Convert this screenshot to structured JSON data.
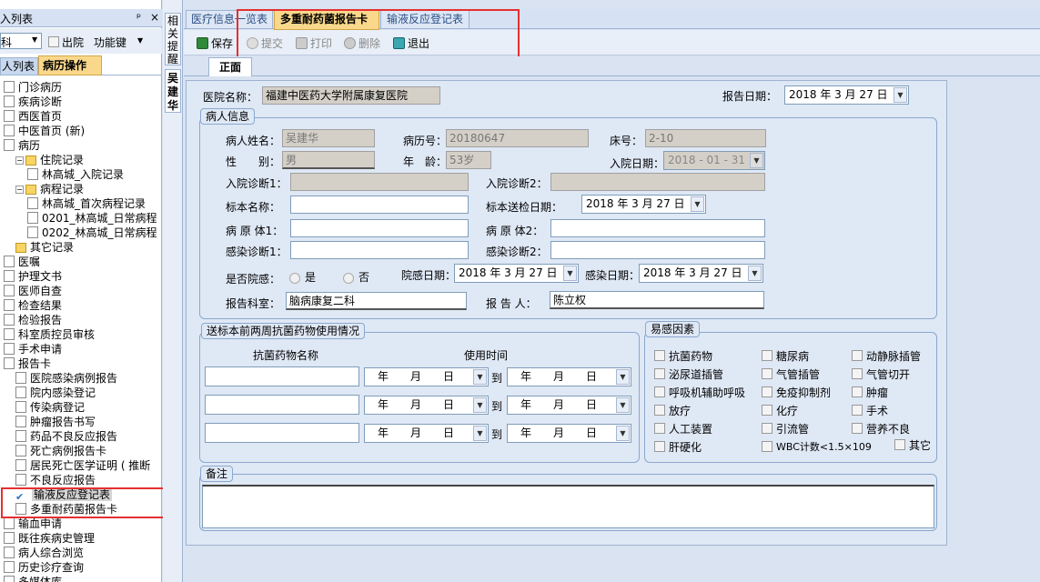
{
  "header": {
    "fragment": "入列表"
  },
  "left": {
    "filter_value": "科",
    "discharge_label": "出院",
    "function_key": "功能键",
    "tabs": [
      "人列表",
      "病历操作"
    ],
    "tree": [
      {
        "label": "门诊病历",
        "indent": 0,
        "icon": "doc"
      },
      {
        "label": "疾病诊断",
        "indent": 0,
        "icon": "doc"
      },
      {
        "label": "西医首页",
        "indent": 0,
        "icon": "doc"
      },
      {
        "label": "中医首页 (新)",
        "indent": 0,
        "icon": "doc"
      },
      {
        "label": "病历",
        "indent": 0,
        "icon": "doc"
      },
      {
        "label": "住院记录",
        "indent": 1,
        "icon": "folder",
        "expander": "−"
      },
      {
        "label": "林高城_入院记录",
        "indent": 2,
        "icon": "doc"
      },
      {
        "label": "病程记录",
        "indent": 1,
        "icon": "folder",
        "expander": "−"
      },
      {
        "label": "林高城_首次病程记录",
        "indent": 2,
        "icon": "doc"
      },
      {
        "label": "0201_林高城_日常病程",
        "indent": 2,
        "icon": "doc"
      },
      {
        "label": "0202_林高城_日常病程",
        "indent": 2,
        "icon": "doc"
      },
      {
        "label": "其它记录",
        "indent": 1,
        "icon": "folder"
      },
      {
        "label": "医嘱",
        "indent": 0,
        "icon": "doc"
      },
      {
        "label": "护理文书",
        "indent": 0,
        "icon": "doc"
      },
      {
        "label": "医师自查",
        "indent": 0,
        "icon": "doc"
      },
      {
        "label": "检查结果",
        "indent": 0,
        "icon": "doc"
      },
      {
        "label": "检验报告",
        "indent": 0,
        "icon": "doc"
      },
      {
        "label": "科室质控员审核",
        "indent": 0,
        "icon": "doc"
      },
      {
        "label": "手术申请",
        "indent": 0,
        "icon": "doc"
      },
      {
        "label": "报告卡",
        "indent": 0,
        "icon": "doc"
      },
      {
        "label": "医院感染病例报告",
        "indent": 1,
        "icon": "doc"
      },
      {
        "label": "院内感染登记",
        "indent": 1,
        "icon": "doc"
      },
      {
        "label": "传染病登记",
        "indent": 1,
        "icon": "doc"
      },
      {
        "label": "肿瘤报告书写",
        "indent": 1,
        "icon": "doc"
      },
      {
        "label": "药品不良反应报告",
        "indent": 1,
        "icon": "doc"
      },
      {
        "label": "死亡病例报告卡",
        "indent": 1,
        "icon": "doc"
      },
      {
        "label": "居民死亡医学证明 ( 推断",
        "indent": 1,
        "icon": "doc"
      },
      {
        "label": "不良反应报告",
        "indent": 1,
        "icon": "doc"
      },
      {
        "label": "输液反应登记表",
        "indent": 1,
        "icon": "check",
        "selected": true
      },
      {
        "label": "多重耐药菌报告卡",
        "indent": 1,
        "icon": "doc"
      },
      {
        "label": "输血申请",
        "indent": 0,
        "icon": "doc"
      },
      {
        "label": "既往疾病史管理",
        "indent": 0,
        "icon": "doc"
      },
      {
        "label": "病人综合浏览",
        "indent": 0,
        "icon": "doc"
      },
      {
        "label": "历史诊疗查询",
        "indent": 0,
        "icon": "doc"
      },
      {
        "label": "多媒体库",
        "indent": 0,
        "icon": "doc"
      }
    ]
  },
  "side_tab": {
    "vertical_1": "相关提醒",
    "vertical_2": "吴建华"
  },
  "doc_tabs": [
    "医疗信息一览表",
    "多重耐药菌报告卡",
    "输液反应登记表"
  ],
  "toolbar": {
    "save": "保存",
    "submit": "提交",
    "print": "打印",
    "delete": "删除",
    "exit": "退出"
  },
  "page_tab": "正面",
  "form": {
    "hospital_label": "医院名称：",
    "hospital_value": "福建中医药大学附属康复医院",
    "report_date_label": "报告日期：",
    "report_date_value": "2018 年 3 月 27 日",
    "patient_group_title": "病人信息",
    "name_label": "病人姓名：",
    "name_value": "吴建华",
    "record_label": "病历号：",
    "record_value": "20180647",
    "bed_label": "床号：",
    "bed_value": "2-10",
    "sex_label": "性　　别：",
    "sex_value": "男",
    "age_label": "年　龄：",
    "age_value": "53岁",
    "admit_date_label": "入院日期：",
    "admit_date_value": "2018 - 01 - 31",
    "diag1_label": "入院诊断1：",
    "diag2_label": "入院诊断2：",
    "specimen_label": "标本名称：",
    "send_date_label": "标本送检日期：",
    "send_date_value": "2018 年 3 月 27 日",
    "pathogen1_label": "病 原 体1：",
    "pathogen2_label": "病 原 体2：",
    "infect1_label": "感染诊断1：",
    "infect2_label": "感染诊断2：",
    "hospital_infect_label": "是否院感：",
    "yes_label": "是",
    "no_label": "否",
    "hosp_infect_date_label": "院感日期：",
    "hosp_infect_date_value": "2018 年 3 月 27 日",
    "infect_date_label": "感染日期：",
    "infect_date_value": "2018 年 3 月 27 日",
    "dept_label": "报告科室：",
    "dept_value": "脑病康复二科",
    "reporter_label": "报 告 人：",
    "reporter_value": "陈立权"
  },
  "antibiotic": {
    "title": "送标本前两周抗菌药物使用情况",
    "col_name": "抗菌药物名称",
    "col_time": "使用时间",
    "date_placeholder": "年　　月　　日",
    "to": "到"
  },
  "risk": {
    "title": "易感因素",
    "items": [
      "抗菌药物",
      "糖尿病",
      "动静脉插管",
      "泌尿道插管",
      "气管插管",
      "气管切开",
      "呼吸机辅助呼吸",
      "免疫抑制剂",
      "肿瘤",
      "放疗",
      "化疗",
      "手术",
      "人工装置",
      "引流管",
      "营养不良",
      "肝硬化",
      "WBC计数<1.5×109",
      "其它"
    ]
  },
  "remarks": {
    "title": "备注"
  }
}
